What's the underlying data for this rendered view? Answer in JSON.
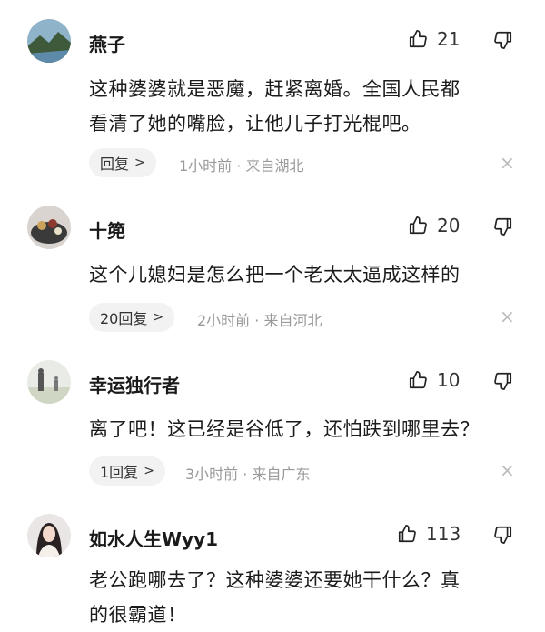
{
  "comments": [
    {
      "username": "燕子",
      "likes": "21",
      "lines": [
        "这种婆婆就是恶魔，赶紧离婚。全国人民都",
        "看清了她的嘴脸，让他儿子打光棍吧。"
      ],
      "reply_label": "回复",
      "time": "1小时前",
      "location": "来自湖北"
    },
    {
      "username": "十篼",
      "likes": "20",
      "lines": [
        "这个儿媳妇是怎么把一个老太太逼成这样的"
      ],
      "reply_label": "20回复",
      "time": "2小时前",
      "location": "来自河北"
    },
    {
      "username": "幸运独行者",
      "likes": "10",
      "lines": [
        "离了吧！这已经是谷低了，还怕跌到哪里去？"
      ],
      "reply_label": "1回复",
      "time": "3小时前",
      "location": "来自广东"
    },
    {
      "username": "如水人生Wyy1",
      "likes": "113",
      "lines": [
        "老公跑哪去了？这种婆婆还要她干什么？真",
        "的很霸道！"
      ]
    }
  ],
  "meta_separator": "·",
  "chevron": ">",
  "close_glyph": "×",
  "icons": {
    "like": "thumbs-up-icon",
    "dislike": "thumbs-down-icon",
    "close": "close-icon"
  }
}
